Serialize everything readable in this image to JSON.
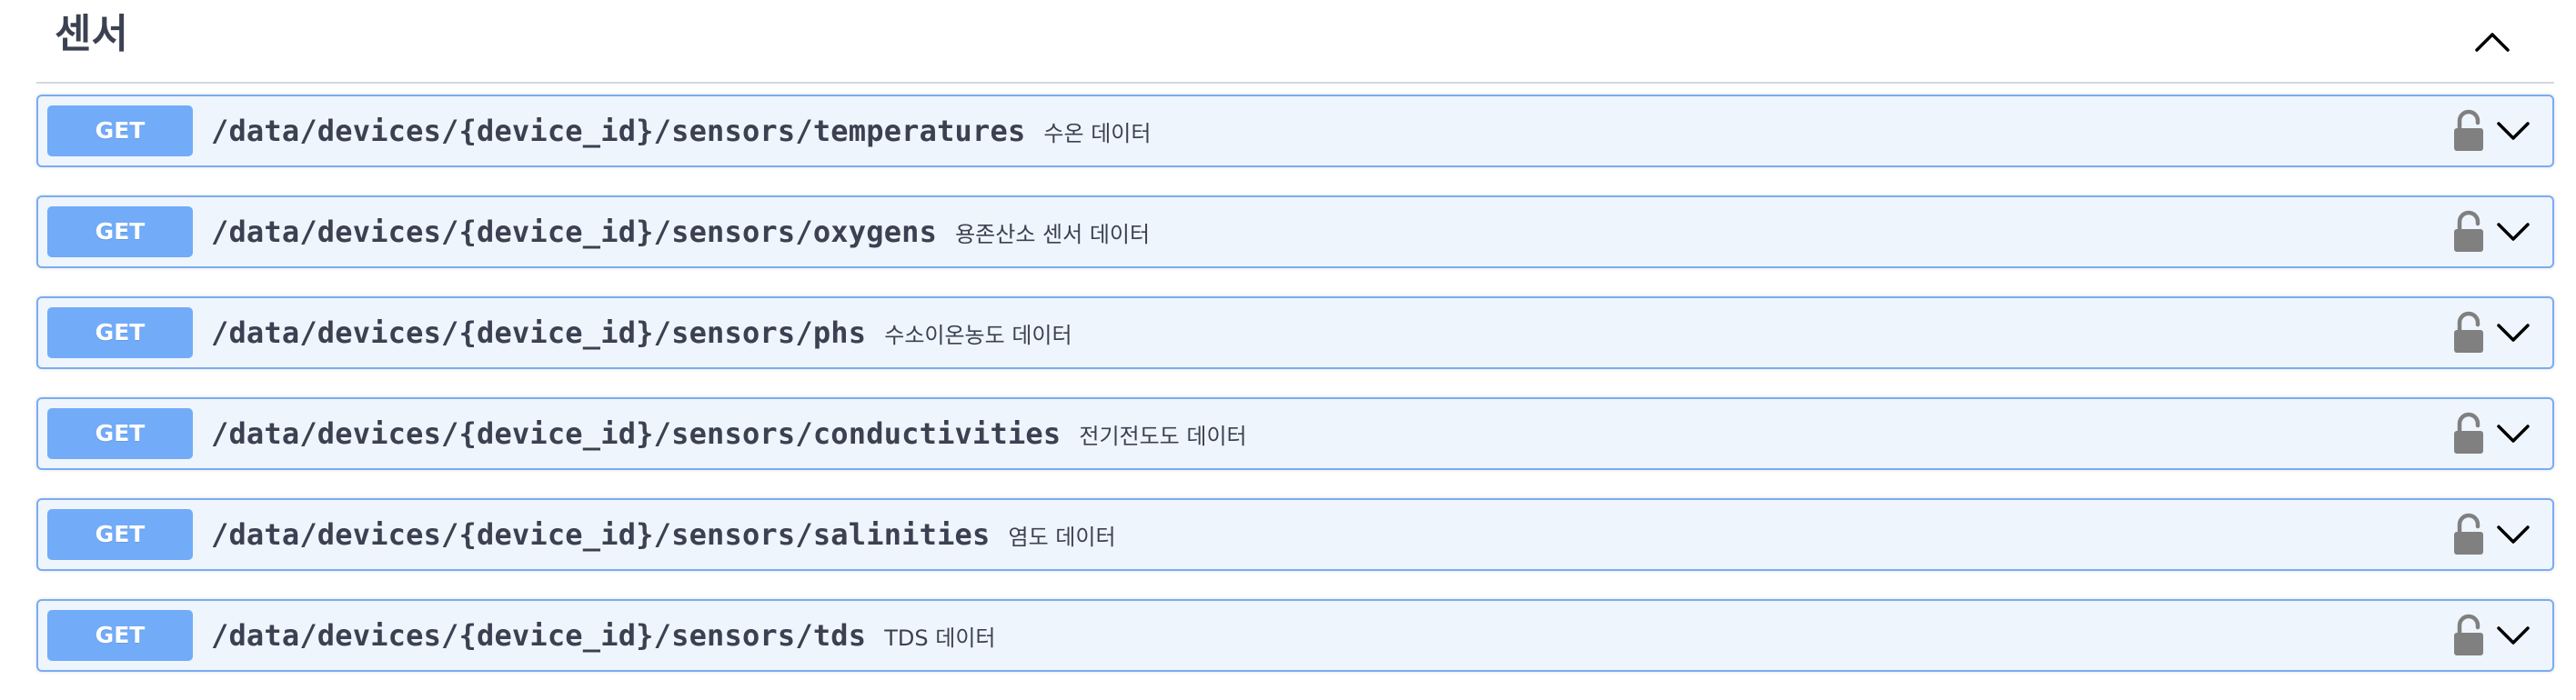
{
  "section": {
    "title": "센서",
    "toggle_icon": "chevron-up-icon"
  },
  "operations": [
    {
      "method": "GET",
      "path": "/data/devices/{device_id}/sensors/temperatures",
      "summary": "수온 데이터"
    },
    {
      "method": "GET",
      "path": "/data/devices/{device_id}/sensors/oxygens",
      "summary": "용존산소 센서 데이터"
    },
    {
      "method": "GET",
      "path": "/data/devices/{device_id}/sensors/phs",
      "summary": "수소이온농도 데이터"
    },
    {
      "method": "GET",
      "path": "/data/devices/{device_id}/sensors/conductivities",
      "summary": "전기전도도 데이터"
    },
    {
      "method": "GET",
      "path": "/data/devices/{device_id}/sensors/salinities",
      "summary": "염도 데이터"
    },
    {
      "method": "GET",
      "path": "/data/devices/{device_id}/sensors/tds",
      "summary": "TDS 데이터"
    }
  ],
  "colors": {
    "get_method_bg": "#72abf8",
    "get_block_bg": "#eff5fd",
    "get_block_border": "#7aacf3",
    "text": "#3b4151",
    "icon": "#808080"
  },
  "icons": {
    "lock": "unlocked-padlock-icon",
    "expand": "chevron-down-icon"
  }
}
